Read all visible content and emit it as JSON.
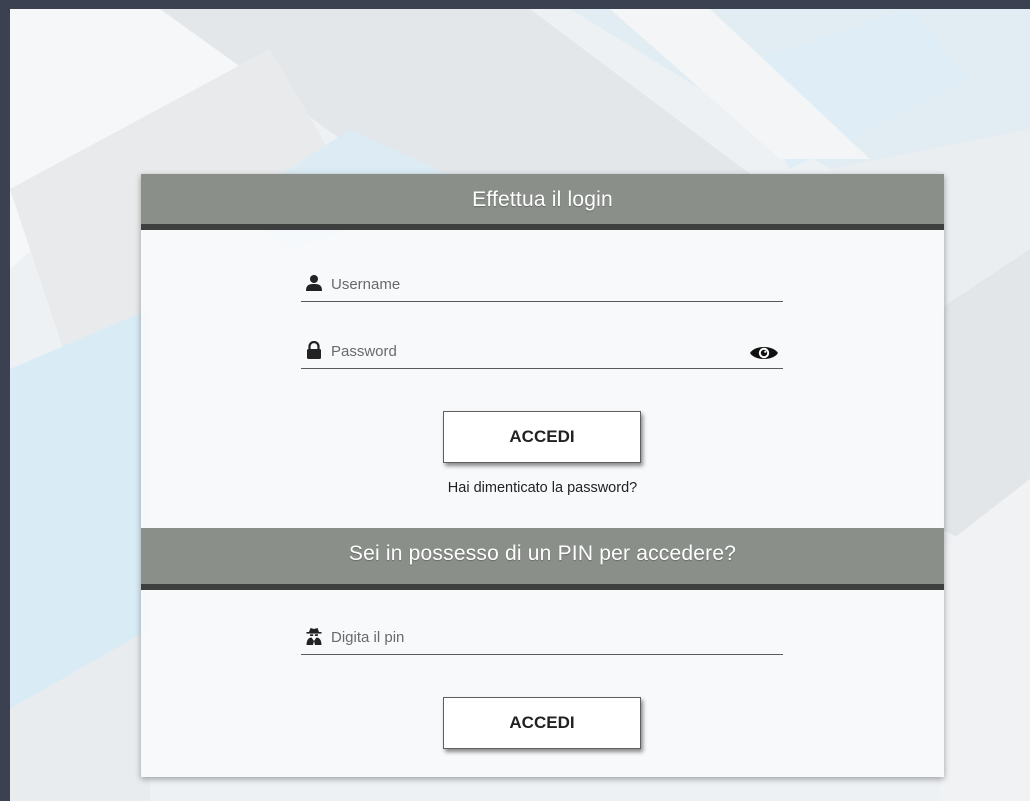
{
  "login_section": {
    "title": "Effettua il login",
    "username": {
      "placeholder": "Username",
      "value": "",
      "icon": "user-icon"
    },
    "password": {
      "placeholder": "Password",
      "value": "",
      "icon": "lock-icon",
      "toggle_icon": "eye-icon"
    },
    "submit_label": "ACCEDI",
    "forgot_password_link": "Hai dimenticato la password?"
  },
  "pin_section": {
    "title": "Sei in possesso di un PIN per accedere?",
    "pin": {
      "placeholder": "Digita il pin",
      "value": "",
      "icon": "user-secret-icon"
    },
    "submit_label": "ACCEDI"
  },
  "colors": {
    "header_bg": "#8a8f89",
    "header_border": "#3d3f3f",
    "page_frame": "#3b4150",
    "card_bg": "#f8fafb"
  }
}
